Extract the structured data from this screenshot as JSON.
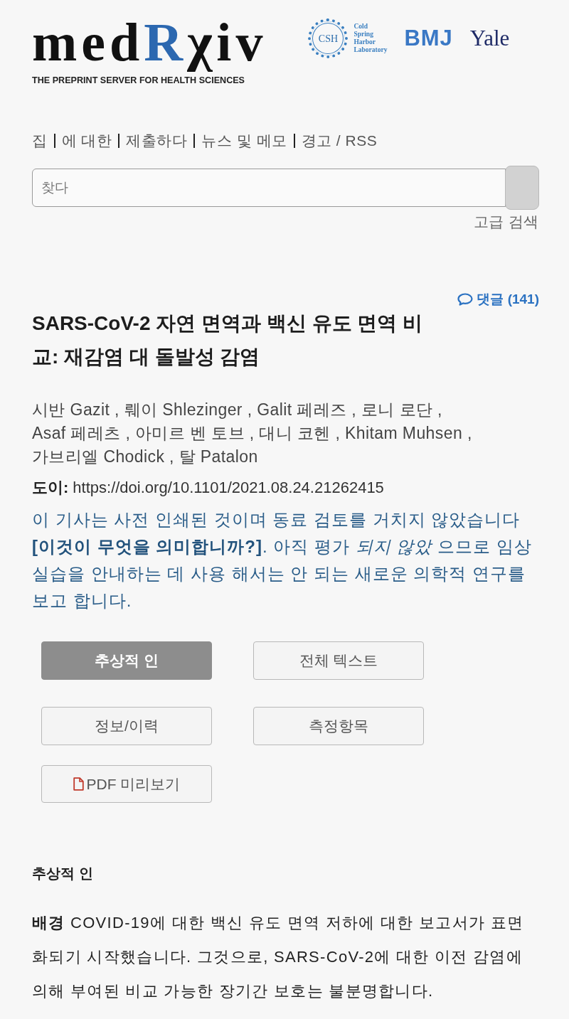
{
  "header": {
    "logo": {
      "start": "med",
      "highlight": "R",
      "end": "χiv"
    },
    "tagline": "THE PREPRINT SERVER FOR HEALTH SCIENCES",
    "partners": [
      {
        "kind": "csh",
        "emblem": "CSH",
        "lines": [
          "Cold",
          "Spring",
          "Harbor",
          "Laboratory"
        ]
      },
      {
        "kind": "bmj",
        "text": "BMJ"
      },
      {
        "kind": "yale",
        "text": "Yale"
      }
    ]
  },
  "nav": [
    "집",
    "에 대한",
    "제출하다",
    "뉴스 및 메모",
    "경고 / RSS"
  ],
  "search": {
    "placeholder": "찾다",
    "advanced_link": "고급 검색"
  },
  "article": {
    "comments": "댓글 (141)",
    "title": "SARS-CoV-2 자연 면역과 백신 유도 면역 비교: 재감염 대 돌발성 감염",
    "authors": "시반 Gazit , 뤠이 Shlezinger , Galit 페레즈 , 로니 로단 , Asaf 페레츠 , 아미르 벤 토브 , 대니 코헨 , Khitam Muhsen , 가브리엘 Chodick , 탈 Patalon",
    "doi_label": "도이:",
    "doi": "https://doi.org/10.1101/2021.08.24.21262415",
    "notice": {
      "before": "이 기사는 사전 인쇄된 것이며 동료 검토를 거치지 않았습니다 ",
      "link": "[이것이 무엇을 의미합니까?]",
      "after": ". 아직 평가 *되지 않았* 으므로 임상 실습을 안내하는 데 사용 해서는 안 되는 새로운 의학적 연구를 보고 합니다."
    },
    "tabs": [
      {
        "label": "추상적 인",
        "selected": true
      },
      {
        "label": "전체 텍스트",
        "selected": false
      },
      {
        "label": "정보/이력",
        "selected": false
      },
      {
        "label": "측정항목",
        "selected": false
      }
    ],
    "pdf_button": "PDF 미리보기",
    "abstract": {
      "heading": "추상적 인",
      "text": "**배경** COVID-19에 대한 백신 유도 면역 저하에 대한 보고서가 표면화되기 시작했습니다. 그것으로, SARS-CoV-2에 대한 이전 감염에 의해 부여된 비교 가능한 장기간 보호는 불분명합니다."
    }
  }
}
